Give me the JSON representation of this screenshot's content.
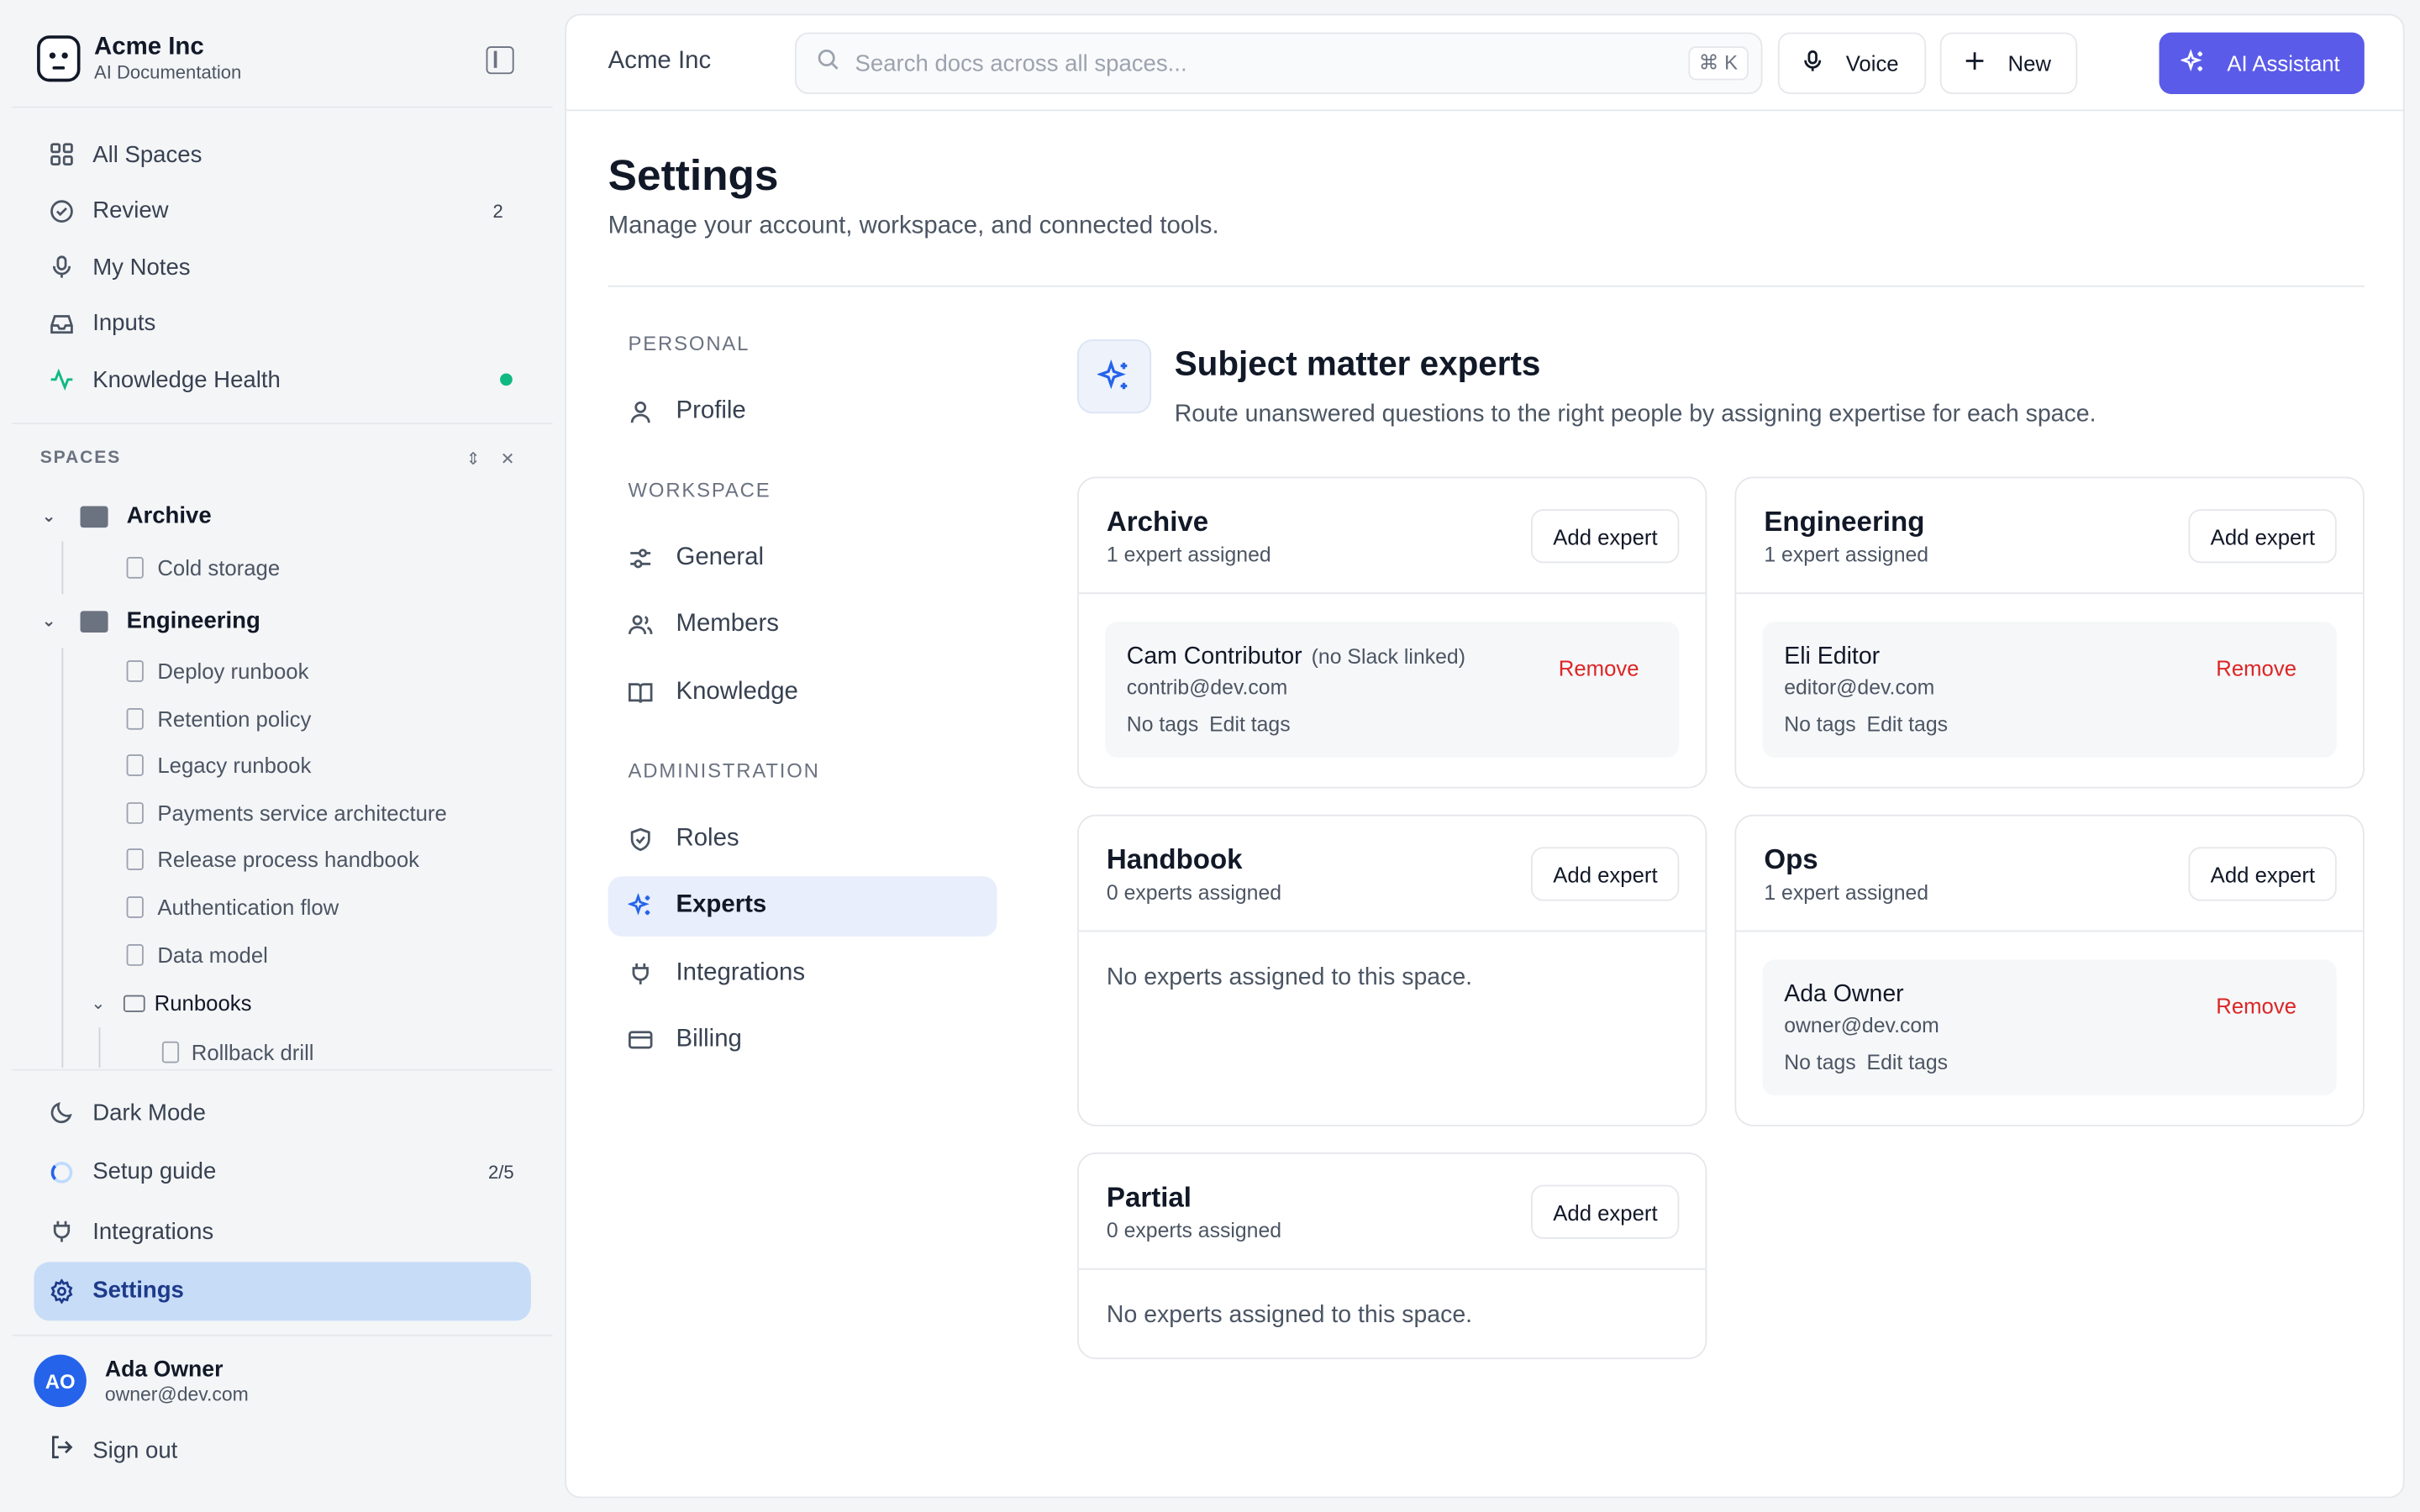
{
  "brand": {
    "name": "Acme Inc",
    "subtitle": "AI Documentation"
  },
  "sidebar": {
    "nav": [
      {
        "label": "All Spaces",
        "icon": "grid-icon"
      },
      {
        "label": "Review",
        "icon": "check-circle-icon",
        "count": "2"
      },
      {
        "label": "My Notes",
        "icon": "mic-icon"
      },
      {
        "label": "Inputs",
        "icon": "inbox-icon"
      },
      {
        "label": "Knowledge Health",
        "icon": "activity-icon",
        "status_color": "#10b981"
      }
    ],
    "spaces_label": "SPACES",
    "tree": {
      "archive": {
        "label": "Archive",
        "children": [
          "Cold storage"
        ]
      },
      "engineering": {
        "label": "Engineering",
        "children": [
          "Deploy runbook",
          "Retention policy",
          "Legacy runbook",
          "Payments service architecture",
          "Release process handbook",
          "Authentication flow",
          "Data model"
        ],
        "runbooks": {
          "label": "Runbooks",
          "children": [
            "Rollback drill"
          ]
        }
      }
    },
    "bottom": [
      {
        "label": "Dark Mode",
        "icon": "moon-icon"
      },
      {
        "label": "Setup guide",
        "icon": "progress-icon",
        "count": "2/5"
      },
      {
        "label": "Integrations",
        "icon": "plug-icon"
      },
      {
        "label": "Settings",
        "icon": "gear-icon",
        "active": true
      }
    ],
    "user": {
      "initials": "AO",
      "name": "Ada Owner",
      "email": "owner@dev.com"
    },
    "signout": "Sign out"
  },
  "topbar": {
    "title": "Acme Inc",
    "search_placeholder": "Search docs across all spaces...",
    "shortcut": "⌘ K",
    "voice": "Voice",
    "new": "New",
    "ai": "AI Assistant",
    "accent": "#5a5be8"
  },
  "page": {
    "title": "Settings",
    "subtitle": "Manage your account, workspace, and connected tools."
  },
  "settings_nav": {
    "personal_label": "PERSONAL",
    "profile": "Profile",
    "workspace_label": "WORKSPACE",
    "general": "General",
    "members": "Members",
    "knowledge": "Knowledge",
    "admin_label": "ADMINISTRATION",
    "roles": "Roles",
    "experts": "Experts",
    "integrations": "Integrations",
    "billing": "Billing"
  },
  "experts": {
    "title": "Subject matter experts",
    "subtitle": "Route unanswered questions to the right people by assigning expertise for each space.",
    "add_label": "Add expert",
    "remove_label": "Remove",
    "no_tags": "No tags",
    "edit_tags": "Edit tags",
    "empty": "No experts assigned to this space.",
    "cards": {
      "archive": {
        "title": "Archive",
        "count": "1 expert assigned",
        "expert": {
          "name": "Cam Contributor",
          "note": "(no Slack linked)",
          "email": "contrib@dev.com"
        }
      },
      "engineering": {
        "title": "Engineering",
        "count": "1 expert assigned",
        "expert": {
          "name": "Eli Editor",
          "email": "editor@dev.com"
        }
      },
      "handbook": {
        "title": "Handbook",
        "count": "0 experts assigned"
      },
      "ops": {
        "title": "Ops",
        "count": "1 expert assigned",
        "expert": {
          "name": "Ada Owner",
          "email": "owner@dev.com"
        }
      },
      "partial": {
        "title": "Partial",
        "count": "0 experts assigned"
      }
    }
  }
}
